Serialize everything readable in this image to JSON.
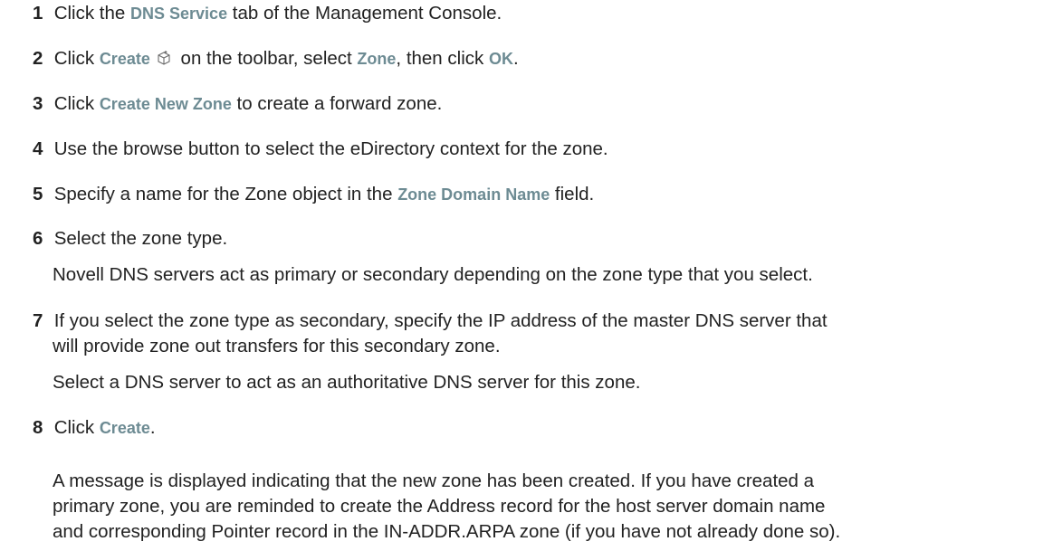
{
  "steps": [
    {
      "number": "1",
      "pre": "Click the ",
      "ui": "DNS Service",
      "post": " tab of the Management Console."
    },
    {
      "number": "2",
      "pre": "Click ",
      "ui1": "Create",
      "icon": "create-cube-icon",
      "mid1": " on the toolbar, select ",
      "ui2": "Zone",
      "mid2": ", then click ",
      "ui3": "OK",
      "post": "."
    },
    {
      "number": "3",
      "pre": "Click ",
      "ui": "Create New Zone",
      "post": " to create a forward zone."
    },
    {
      "number": "4",
      "text": "Use the browse button to select the eDirectory context for the zone."
    },
    {
      "number": "5",
      "pre": "Specify a name for the Zone object in the ",
      "ui": "Zone Domain Name",
      "post": " field."
    },
    {
      "number": "6",
      "text": "Select the zone type.",
      "note": "Novell DNS servers act as primary or secondary depending on the zone type that you select."
    },
    {
      "number": "7",
      "text1": "If you select the zone type as secondary, specify the IP address of the master DNS server that",
      "text2": "will provide zone out transfers for this secondary zone.",
      "note": "Select a DNS server to act as an authoritative DNS server for this zone."
    },
    {
      "number": "8",
      "pre": "Click ",
      "ui": "Create",
      "post": ".",
      "note1": "A message is displayed indicating that the new zone has been created. If you have created a",
      "note2": "primary zone, you are reminded to create the Address record for the host server domain name",
      "note3": "and corresponding Pointer record in the IN-ADDR.ARPA zone (if you have not already done so)."
    }
  ]
}
